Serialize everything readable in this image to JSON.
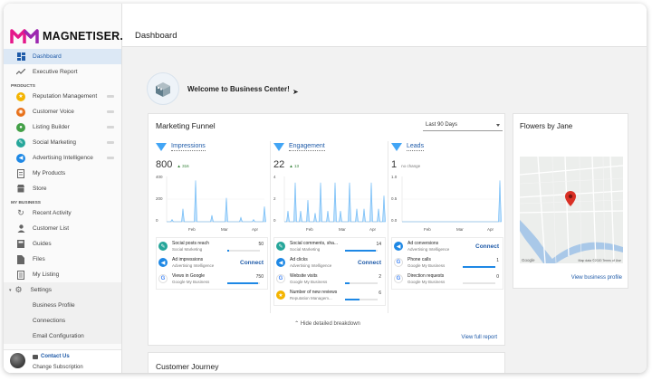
{
  "brand": {
    "name": "MAGNETISER.",
    "accent": "#e5188b"
  },
  "sidebar": {
    "top_items": [
      {
        "label": "Dashboard",
        "icon": "dashboard-icon"
      },
      {
        "label": "Executive Report",
        "icon": "trend-icon"
      }
    ],
    "products_heading": "PRODUCTS",
    "products": [
      {
        "label": "Reputation Management",
        "icon": "star-icon",
        "color": "#f4b400"
      },
      {
        "label": "Customer Voice",
        "icon": "voice-icon",
        "color": "#e8711a"
      },
      {
        "label": "Listing Builder",
        "icon": "pin-icon",
        "color": "#43a047"
      },
      {
        "label": "Social Marketing",
        "icon": "social-icon",
        "color": "#26a69a"
      },
      {
        "label": "Advertising Intelligence",
        "icon": "ads-icon",
        "color": "#1e88e5"
      },
      {
        "label": "My Products",
        "icon": "document-icon",
        "color": ""
      },
      {
        "label": "Store",
        "icon": "store-icon",
        "color": ""
      }
    ],
    "business_heading": "MY BUSINESS",
    "business": [
      {
        "label": "Recent Activity",
        "icon": "history-icon"
      },
      {
        "label": "Customer List",
        "icon": "person-icon"
      },
      {
        "label": "Guides",
        "icon": "book-icon"
      },
      {
        "label": "Files",
        "icon": "file-icon"
      },
      {
        "label": "My Listing",
        "icon": "listing-icon"
      }
    ],
    "settings": {
      "label": "Settings",
      "sub": [
        "Business Profile",
        "Connections",
        "Email Configuration"
      ]
    },
    "footer": {
      "contact": "Contact Us",
      "change": "Change Subscription"
    }
  },
  "header": {
    "title": "Dashboard"
  },
  "welcome": {
    "text": "Welcome to Business Center!"
  },
  "funnel": {
    "title": "Marketing Funnel",
    "range": "Last 90 Days",
    "hide_label": "Hide detailed breakdown",
    "view_report": "View full report",
    "columns": [
      {
        "title": "Impressions",
        "value": "800",
        "delta": "▲ 316",
        "yticks": [
          "400",
          "200",
          "0"
        ],
        "xticks": [
          "Feb",
          "Mar",
          "Apr"
        ],
        "metrics": [
          {
            "name": "Social posts reach",
            "source": "Social Marketing",
            "value": "50",
            "bar": 0.05,
            "icon": "social-icon",
            "color": "#26a69a"
          },
          {
            "name": "Ad impressions",
            "source": "Advertising Intelligence",
            "connect": "Connect",
            "icon": "ads-icon",
            "color": "#1e88e5"
          },
          {
            "name": "Views in Google",
            "source": "Google My Business",
            "value": "750",
            "bar": 0.95,
            "icon": "google-icon",
            "color": "#ea4335"
          }
        ]
      },
      {
        "title": "Engagement",
        "value": "22",
        "delta": "▲ 13",
        "yticks": [
          "4",
          "2",
          "0"
        ],
        "xticks": [
          "Feb",
          "Mar",
          "Apr"
        ],
        "metrics": [
          {
            "name": "Social comments, sha...",
            "source": "Social Marketing",
            "value": "14",
            "bar": 0.95,
            "icon": "social-icon",
            "color": "#26a69a"
          },
          {
            "name": "Ad clicks",
            "source": "Advertising Intelligence",
            "connect": "Connect",
            "icon": "ads-icon",
            "color": "#1e88e5"
          },
          {
            "name": "Website visits",
            "source": "Google My Business",
            "value": "2",
            "bar": 0.15,
            "icon": "google-icon",
            "color": "#ea4335"
          },
          {
            "name": "Number of new reviews",
            "source": "Reputation Managem...",
            "value": "6",
            "bar": 0.45,
            "icon": "star-icon",
            "color": "#f4b400"
          }
        ]
      },
      {
        "title": "Leads",
        "value": "1",
        "delta": "no change",
        "yticks": [
          "1.0",
          "0.5",
          "0.0"
        ],
        "xticks": [
          "Feb",
          "Mar",
          "Apr"
        ],
        "metrics": [
          {
            "name": "Ad conversions",
            "source": "Advertising Intelligence",
            "connect": "Connect",
            "icon": "ads-icon",
            "color": "#1e88e5"
          },
          {
            "name": "Phone calls",
            "source": "Google My Business",
            "value": "1",
            "bar": 1.0,
            "icon": "google-icon",
            "color": "#ea4335"
          },
          {
            "name": "Direction requests",
            "source": "Google My Business",
            "value": "0",
            "bar": 0.0,
            "icon": "google-icon",
            "color": "#ea4335"
          }
        ]
      }
    ]
  },
  "map_card": {
    "title": "Flowers by Jane",
    "link": "View business profile",
    "attribution": "Map data ©2020   Terms of Use",
    "logo": "Google"
  },
  "journey": {
    "title": "Customer Journey"
  }
}
